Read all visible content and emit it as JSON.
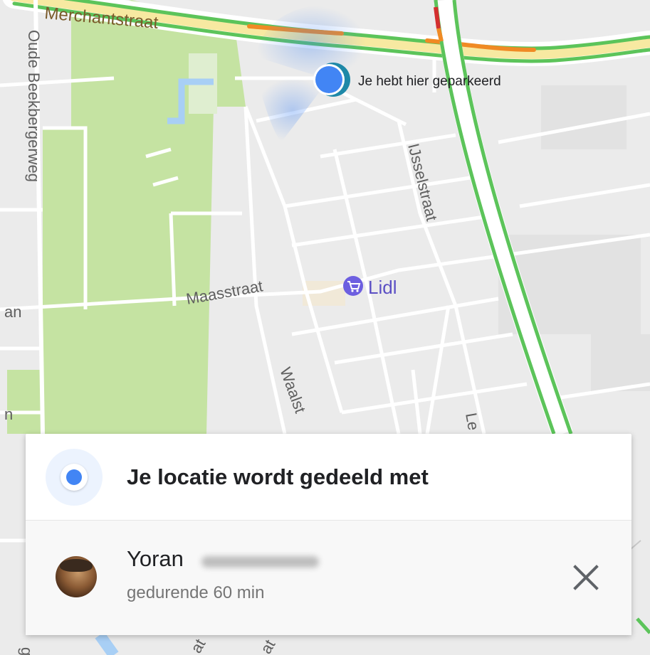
{
  "map": {
    "streets": {
      "merchantstraat": "Merchantstraat",
      "oude_beekbergerweg": "Oude Beekbergerweg",
      "ijsselstraat": "IJsselstraat",
      "maasstraat": "Maasstraat",
      "waalstraat": "Waalst",
      "lekstraat": "Le",
      "left_an": "an",
      "left_n": "n",
      "bottom_left": "g",
      "bottom_mid1": "at",
      "bottom_mid2": "at"
    },
    "parked_label": "Je hebt hier geparkeerd",
    "poi": {
      "name": "Lidl",
      "icon": "shopping-cart-icon"
    },
    "colors": {
      "traffic_green": "#5cc45a",
      "traffic_orange": "#f08a24",
      "traffic_red": "#d32f2f",
      "park": "#c5e3a2",
      "location_blue": "#4285f4"
    }
  },
  "share_card": {
    "title": "Je locatie wordt gedeeld met",
    "contact": {
      "name": "Yoran",
      "duration": "gedurende 60 min"
    },
    "close_icon": "close-icon"
  }
}
